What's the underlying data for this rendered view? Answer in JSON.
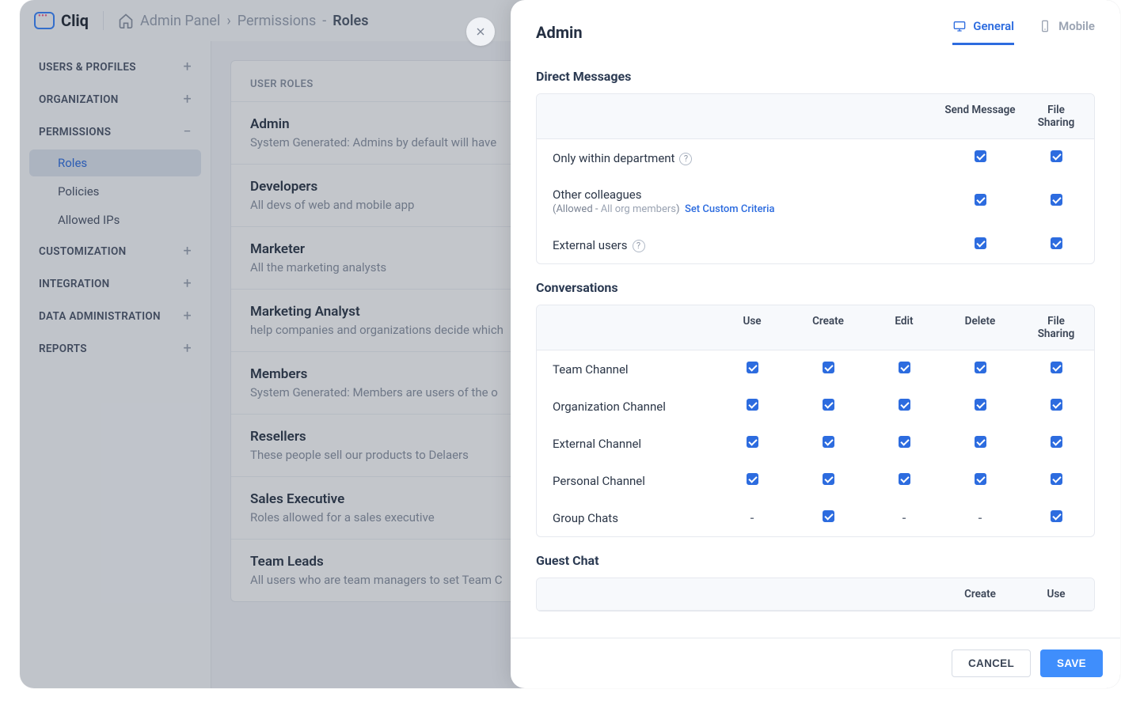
{
  "app": {
    "name": "Cliq"
  },
  "breadcrumbs": {
    "home_label": "Admin Panel",
    "mid": "Permissions",
    "current": "Roles"
  },
  "sidebar": {
    "sections": [
      {
        "label": "USERS & PROFILES",
        "expandable": true
      },
      {
        "label": "ORGANIZATION",
        "expandable": true
      },
      {
        "label": "PERMISSIONS",
        "expandable": true,
        "expanded": true,
        "items": [
          {
            "label": "Roles",
            "active": true
          },
          {
            "label": "Policies"
          },
          {
            "label": "Allowed IPs"
          }
        ]
      },
      {
        "label": "CUSTOMIZATION",
        "expandable": true
      },
      {
        "label": "INTEGRATION",
        "expandable": true
      },
      {
        "label": "DATA ADMINISTRATION",
        "expandable": true
      },
      {
        "label": "REPORTS",
        "expandable": true
      }
    ]
  },
  "rolesPanel": {
    "heading": "USER ROLES",
    "roles": [
      {
        "title": "Admin",
        "desc": "System Generated: Admins by default will have"
      },
      {
        "title": "Developers",
        "desc": "All devs of web and mobile app"
      },
      {
        "title": "Marketer",
        "desc": "All the marketing analysts"
      },
      {
        "title": "Marketing Analyst",
        "desc": "help companies and organizations decide which"
      },
      {
        "title": "Members",
        "desc": "System Generated: Members are users of the o"
      },
      {
        "title": "Resellers",
        "desc": "These people sell our products to Delaers"
      },
      {
        "title": "Sales Executive",
        "desc": "Roles allowed for a sales executive"
      },
      {
        "title": "Team Leads",
        "desc": "All users who are team managers to set Team C"
      }
    ]
  },
  "drawer": {
    "title": "Admin",
    "tabs": [
      {
        "label": "General",
        "active": true
      },
      {
        "label": "Mobile"
      }
    ],
    "sections": {
      "dm": {
        "title": "Direct Messages",
        "columns": [
          "Send Message",
          "File Sharing"
        ],
        "rows": [
          {
            "label": "Only within department",
            "help": true,
            "vals": [
              true,
              true
            ]
          },
          {
            "label": "Other colleagues",
            "note_prefix": "(Allowed - ",
            "note_muted": "All org members",
            "note_suffix": ")",
            "link": "Set Custom Criteria",
            "vals": [
              true,
              true
            ]
          },
          {
            "label": "External users",
            "help": true,
            "vals": [
              true,
              true
            ]
          }
        ]
      },
      "conv": {
        "title": "Conversations",
        "columns": [
          "Use",
          "Create",
          "Edit",
          "Delete",
          "File Sharing"
        ],
        "rows": [
          {
            "label": "Team Channel",
            "vals": [
              true,
              true,
              true,
              true,
              true
            ]
          },
          {
            "label": "Organization Channel",
            "vals": [
              true,
              true,
              true,
              true,
              true
            ]
          },
          {
            "label": "External Channel",
            "vals": [
              true,
              true,
              true,
              true,
              true
            ]
          },
          {
            "label": "Personal Channel",
            "vals": [
              true,
              true,
              true,
              true,
              true
            ]
          },
          {
            "label": "Group Chats",
            "vals": [
              "-",
              true,
              "-",
              "-",
              true
            ]
          }
        ]
      },
      "guest": {
        "title": "Guest Chat",
        "columns": [
          "Create",
          "Use"
        ]
      }
    },
    "footer": {
      "cancel": "CANCEL",
      "save": "SAVE"
    }
  }
}
